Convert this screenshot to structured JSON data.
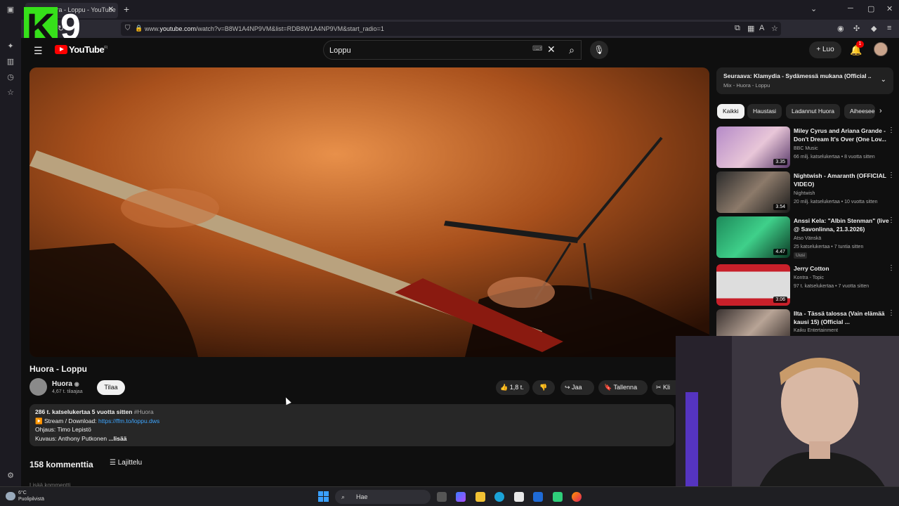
{
  "browser": {
    "tab_title": "Huora - Loppu - YouTube",
    "url_prefix": "www.",
    "url_host": "youtube.com",
    "url_rest": "/watch?v=B8W1A4NP9VM&list=RDB8W1A4NP9VM&start_radio=1"
  },
  "overlay": {
    "k": "K",
    "number": "9"
  },
  "header": {
    "logo_text": "YouTube",
    "logo_region": "FI",
    "search_value": "Loppu",
    "create_label": "Luo",
    "notification_count": "1"
  },
  "video": {
    "title": "Huora - Loppu",
    "channel": "Huora",
    "subscribers": "4,67 t. tilaajaa",
    "subscribe_label": "Tilaa",
    "likes": "1,8 t.",
    "share_label": "Jaa",
    "save_label": "Tallenna",
    "clip_label": "Kli"
  },
  "description": {
    "stats": "286 t. katselukertaa  5 vuotta sitten",
    "hashtag": "#Huora",
    "stream_label": "▶️ Stream / Download:",
    "stream_link": "https://ffm.to/loppu.dws",
    "director": "Ohjaus: Timo Lepistö",
    "camera": "Kuvaus: Anthony Putkonen",
    "more": "...lisää"
  },
  "comments": {
    "count_label": "158 kommenttia",
    "sort_label": "Lajittelu",
    "add_placeholder": "Lisää kommentti..."
  },
  "queue": {
    "next_title": "Seuraava: Klamydia - Sydämessä mukana (Official ...",
    "subtitle": "Mix - Huora - Loppu"
  },
  "chips": [
    "Kaikki",
    "Haustasi",
    "Ladannut Huora",
    "Aiheeseen liittyvät"
  ],
  "recommendations": [
    {
      "title": "Miley Cyrus and Ariana Grande - Don't Dream It's Over (One Lov...",
      "channel": "BBC Music",
      "meta": "66 milj. katselukertaa • 8 vuotta sitten",
      "duration": "3.35"
    },
    {
      "title": "Nightwish - Amaranth (OFFICIAL VIDEO)",
      "channel": "Nightwish",
      "meta": "20 milj. katselukertaa • 10 vuotta sitten",
      "duration": "3.54"
    },
    {
      "title": "Anssi Kela: \"Albin Stenman\" (live @ Savonlinna, 21.3.2026)",
      "channel": "Atso Vänskä",
      "meta": "25 katselukertaa • 7 tuntia sitten",
      "badge": "Uusi",
      "duration": "4.47"
    },
    {
      "title": "Jerry Cotton",
      "channel": "Kontra - Topic",
      "meta": "97 t. katselukertaa • 7 vuotta sitten",
      "duration": "3.06"
    },
    {
      "title": "Ilta - Tässä talossa (Vain elämää kausi 15) (Official ...",
      "channel": "Kaiku Entertainment",
      "meta": "",
      "duration": ""
    }
  ],
  "taskbar": {
    "temp": "6°C",
    "weather": "Puolipilvistä",
    "search_placeholder": "Hae"
  },
  "colors": {
    "brand_red": "#ff0000",
    "link_blue": "#3ea6ff",
    "overlay_green": "#36e01a"
  }
}
